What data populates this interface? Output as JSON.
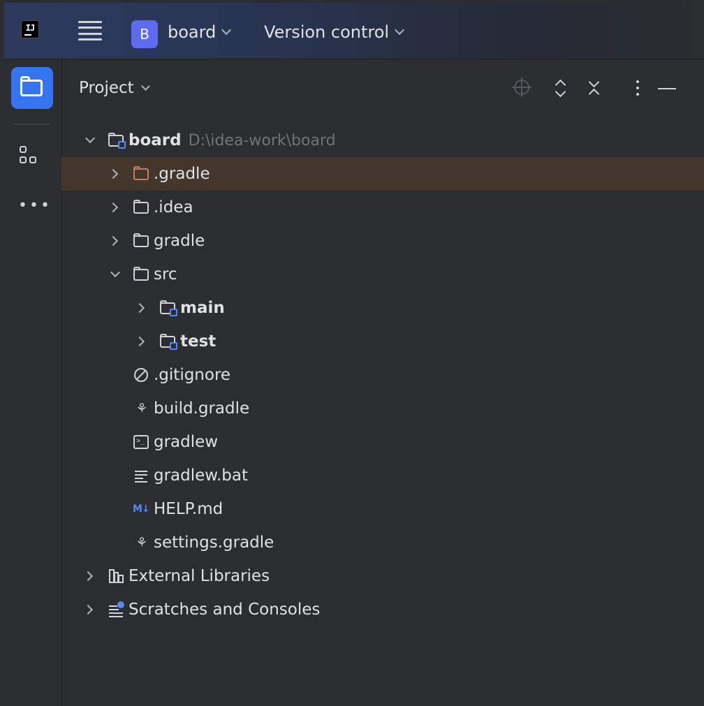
{
  "titlebar": {
    "logo_text": "IJ",
    "project_badge": "B",
    "project_name": "board",
    "vcs_menu": "Version control"
  },
  "panel": {
    "title": "Project"
  },
  "tree": {
    "root": {
      "label": "board",
      "path": "D:\\idea-work\\board"
    },
    "items": [
      {
        "label": ".gradle"
      },
      {
        "label": ".idea"
      },
      {
        "label": "gradle"
      },
      {
        "label": "src"
      },
      {
        "label": "main"
      },
      {
        "label": "test"
      },
      {
        "label": ".gitignore"
      },
      {
        "label": "build.gradle"
      },
      {
        "label": "gradlew"
      },
      {
        "label": "gradlew.bat"
      },
      {
        "label": "HELP.md"
      },
      {
        "label": "settings.gradle"
      },
      {
        "label": "External Libraries"
      },
      {
        "label": "Scratches and Consoles"
      }
    ]
  },
  "icons": {
    "md_badge": "M↓"
  },
  "colors": {
    "accent": "#3574f0",
    "badge": "#5c6bf0",
    "selection": "#43362b",
    "excluded_folder": "#c77d55",
    "module_marker": "#548af7"
  }
}
